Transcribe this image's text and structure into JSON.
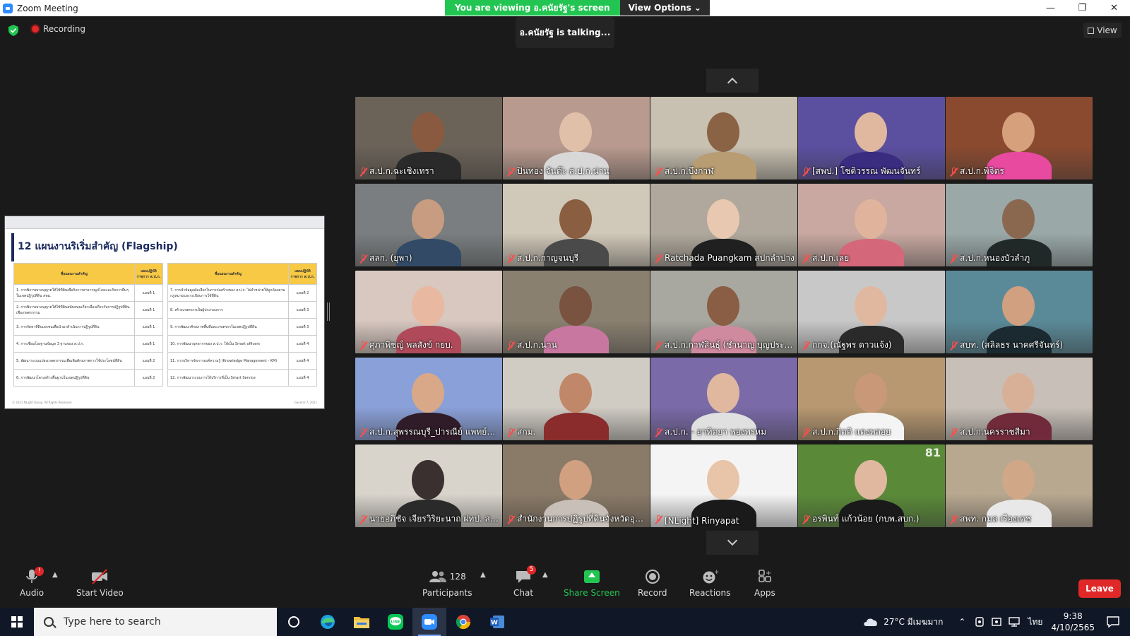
{
  "window": {
    "title": "Zoom Meeting",
    "minimize": "—",
    "maximize": "❐",
    "close": "✕"
  },
  "share_banner": {
    "viewing_text": "You are viewing อ.คนัยรัฐ's screen",
    "view_options": "View Options ⌄"
  },
  "status": {
    "recording": "Recording",
    "talking": "อ.คนัยรัฐ is talking...",
    "view": "View"
  },
  "slide": {
    "title": "12 แผนงานริเริ่มสำคัญ (Flagship)",
    "left_headers": [
      "ชื่อแผนงานสำคัญ",
      "แผนปฏิบัติราชการ ส.ป.ก."
    ],
    "right_headers": [
      "ชื่อแผนงานสำคัญ",
      "แผนปฏิบัติราชการ ส.ป.ก."
    ],
    "left_rows": [
      [
        "1. การพิจารณาอนุญาตให้ใช้ที่ดินเพื่อกิจการสาธารณูปโภคและกิจการอื่นๆ ในเขตปฏิรูปที่ดิน สทม.",
        "แผนที่ 1"
      ],
      [
        "2. การพิจารณาอนุญาตให้ใช้ที่ดินสนับสนุนเกี่ยวเนื่องเกี่ยวกับการปฏิรูปที่ดินเพื่อเกษตรกรรม",
        "แผนที่ 1"
      ],
      [
        "3. การจัดหาที่ดินเอกชนเพื่อนำมาดำเนินการปฏิรูปที่ดิน",
        "แผนที่ 1"
      ],
      [
        "4. การเชื่อมโยงฐานข้อมูล 3 ฐานของ ส.ป.ก.",
        "แผนที่ 1"
      ],
      [
        "5. พัฒนาระบบแปลงเกษตรกรรมเพื่อเพิ่มศักยภาพการใช้ประโยชน์ที่ดิน",
        "แผนที่ 2"
      ],
      [
        "6. การพัฒนาโครงสร้างพื้นฐานในเขตปฏิรูปที่ดิน",
        "แผนที่ 2"
      ]
    ],
    "right_rows": [
      [
        "7. การนำข้อมูลคัดเลือกในการก่อสร้างของ ส.ป.ก. ไปจำหน่ายให้ลูกค้องตามกฎหมายและระเบียบการใช้ที่ดิน",
        "แผนที่ 2"
      ],
      [
        "8. สร้างเกษตรกรเป็นผู้ประกอบการ",
        "แผนที่ 3"
      ],
      [
        "9. การพัฒนาศักยภาพพื้นที่และเกษตรกรในเขตปฏิรูปที่ดิน",
        "แผนที่ 3"
      ],
      [
        "10. การพัฒนาบุคลากรของ ส.ป.ก. ให้เป็น Smart officers",
        "แผนที่ 4"
      ],
      [
        "11. การบริหารจัดการองค์ความรู้ (Knowledge Management - KM)",
        "แผนที่ 4"
      ],
      [
        "12. การพัฒนาระบบการให้บริการที่เป็น Smart Service",
        "แผนที่ 4"
      ]
    ],
    "footer_left": "© 2021 NLight Group. All Rights Reserved",
    "footer_right": "General 7, 2021"
  },
  "participants_tiles": [
    {
      "name": "ส.ป.ก.ฉะเชิงเทรา",
      "bg": "#6b6258",
      "skin": "#8a5a40",
      "shirt": "#2a2a2a"
    },
    {
      "name": "ปินทอง จันต๊ะ ส.ป.ก.น่าน",
      "bg": "#b89a8f",
      "skin": "#e0c0a8",
      "shirt": "#d8d8d8"
    },
    {
      "name": "ส.ป.ก.บึงกาฬ",
      "bg": "#c8c0b0",
      "skin": "#8a6244",
      "shirt": "#b89c72"
    },
    {
      "name": "[สพป.] โชติวรรณ พัฒนจันทร์",
      "bg": "#5b4fa0",
      "skin": "#e0b8a0",
      "shirt": "#3a2c80"
    },
    {
      "name": "ส.ป.ก.พิจิตร",
      "bg": "#8a4a30",
      "skin": "#d6a07c",
      "shirt": "#e84aa0"
    },
    {
      "name": "สลก. (ยุพา)",
      "bg": "#7a7e80",
      "skin": "#c89c80",
      "shirt": "#324a66"
    },
    {
      "name": "ส.ป.ก.กาญจนบุรี",
      "bg": "#d0c8b8",
      "skin": "#8a5e40",
      "shirt": "#4a4a4a"
    },
    {
      "name": "Ratchada Puangkam สปกลำปาง",
      "bg": "#b0a89c",
      "skin": "#e8c8b0",
      "shirt": "#202020"
    },
    {
      "name": "ส.ป.ก.เลย",
      "bg": "#c8a8a0",
      "skin": "#e0b49c",
      "shirt": "#d4687a"
    },
    {
      "name": "ส.ป.ก.หนองบัวลำภู",
      "bg": "#9aa8a8",
      "skin": "#8a6850",
      "shirt": "#202828"
    },
    {
      "name": "ศุภาพิชญ์ พลสังข์ กยบ.",
      "bg": "#d8c8c0",
      "skin": "#e8b8a0",
      "shirt": "#b04a5a"
    },
    {
      "name": "ส.ป.ก.น่าน",
      "bg": "#8a8070",
      "skin": "#7a5240",
      "shirt": "#c878a0"
    },
    {
      "name": "ส.ป.ก.กาฬสินธุ์ (ชำนาญ บุญประส...",
      "bg": "#a8a8a0",
      "skin": "#8a5e44",
      "shirt": "#d08aa0"
    },
    {
      "name": "กกจ.(ณัฐพร ดาวแจ้ง)",
      "bg": "#c8c8c8",
      "skin": "#e0b8a0",
      "shirt": "#2a2a2a"
    },
    {
      "name": "สบท. (สลิลธร นาคศรีจันทร์)",
      "bg": "#5a8a98",
      "skin": "#d0a080",
      "shirt": "#1a2a30"
    },
    {
      "name": "ส.ป.ก.สุพรรณบุรี_ปารณีย์ แพทย์ปร...",
      "bg": "#8aa0d8",
      "skin": "#d8a888",
      "shirt": "#301c28"
    },
    {
      "name": "สกม.",
      "bg": "#d0ccc4",
      "skin": "#c08868",
      "shirt": "#8a2c2c"
    },
    {
      "name": "ส.ป.ก. - อาทิตยา พองพรหม",
      "bg": "#7a6aa8",
      "skin": "#e0b8a0",
      "shirt": "#e0e0e0"
    },
    {
      "name": "ส.ป.ก.กิตติ แดงพลอย",
      "bg": "#b89870",
      "skin": "#c89878",
      "shirt": "#f4f4f4"
    },
    {
      "name": "ส.ป.ก.นครราชสีมา",
      "bg": "#c8c0b8",
      "skin": "#d8b098",
      "shirt": "#702a3a"
    },
    {
      "name": "นายอภิชัจ เจียรวิริยะนาถ ฝทป. สกม.",
      "bg": "#d8d4cc",
      "skin": "#3a3030",
      "shirt": "#2a2a2a"
    },
    {
      "name": "สำนักงานการปฏิรูปที่ดินจังหวัดอุบล...",
      "bg": "#8a7a68",
      "skin": "#d0a080",
      "shirt": "#c8c0b8"
    },
    {
      "name": "[NLight] Rinyapat",
      "bg": "#f4f4f4",
      "skin": "#e8c4a8",
      "shirt": "#1a1a1a"
    },
    {
      "name": "อรพินท์ แก้วน้อย (กบพ.สบก.)",
      "bg": "#5a8a38",
      "skin": "#e0b8a0",
      "shirt": "#1a1a1a",
      "corner": "81"
    },
    {
      "name": "สพท. กมล เรืองเดช",
      "bg": "#b8a890",
      "skin": "#d0a888",
      "shirt": "#e8e8e8"
    }
  ],
  "toolbar": {
    "audio": "Audio",
    "audio_badge": "!",
    "start_video": "Start Video",
    "participants": "Participants",
    "participants_count": "128",
    "chat": "Chat",
    "chat_badge": "5",
    "share_screen": "Share Screen",
    "record": "Record",
    "reactions": "Reactions",
    "apps": "Apps",
    "leave": "Leave"
  },
  "taskbar": {
    "search_placeholder": "Type here to search",
    "weather": "27°C มีเมฆมาก",
    "language": "ไทย",
    "time": "9:38",
    "date": "4/10/2565"
  },
  "colors": {
    "accent_green": "#23c552",
    "leave_red": "#e02828",
    "zoom_blue": "#2d8cff"
  }
}
